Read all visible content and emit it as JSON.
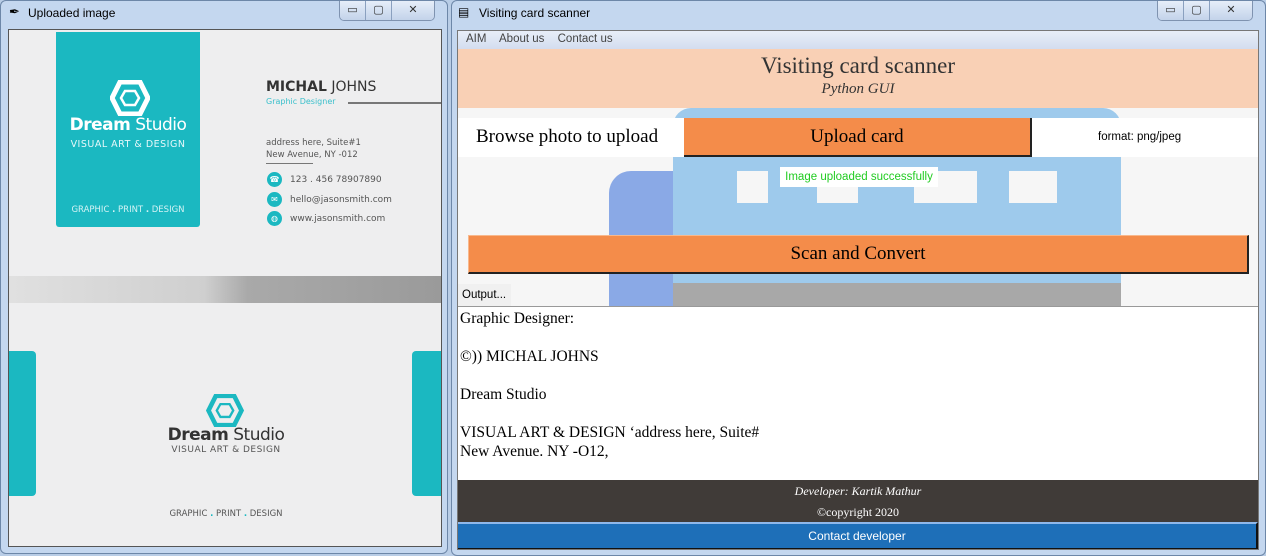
{
  "left_window": {
    "title": "Uploaded image",
    "card_front": {
      "brand_bold": "Dream",
      "brand_light": "Studio",
      "tagline": "VISUAL ART & DESIGN",
      "services": [
        "GRAPHIC",
        ".",
        "PRINT",
        ".",
        "DESIGN"
      ],
      "name_bold": "MICHAL",
      "name_light": "JOHNS",
      "role": "Graphic Designer",
      "address_line1": "address here, Suite#1",
      "address_line2": "New Avenue, NY -012",
      "phone": "123 . 456  78907890",
      "email": "hello@jasonsmith.com",
      "website": "www.jasonsmith.com"
    },
    "card_back": {
      "brand_bold": "Dream",
      "brand_light": "Studio",
      "tagline": "VISUAL ART & DESIGN",
      "services": [
        "GRAPHIC",
        ".",
        "PRINT",
        ".",
        "DESIGN"
      ]
    },
    "accent": "#1bb8c1"
  },
  "right_window": {
    "title": "Visiting card scanner",
    "menu": [
      "AIM",
      "About us",
      "Contact us"
    ],
    "header": {
      "title": "Visiting card scanner",
      "subtitle": "Python GUI"
    },
    "browse_label": "Browse photo to upload",
    "upload_button": "Upload card",
    "format_label": "format: png/jpeg",
    "status": "Image uploaded successfully",
    "scan_button": "Scan and Convert",
    "output_label": "Output...",
    "output_lines": [
      "Graphic Designer:",
      "",
      "©)) MICHAL JOHNS",
      "",
      "Dream Studio",
      "",
      "VISUAL ART & DESIGN ‘address here, Suite#",
      "New Avenue. NY -O12,"
    ],
    "footer": {
      "developer": "Developer: Kartik Mathur",
      "copyright": "©copyright 2020"
    },
    "contact_button": "Contact developer",
    "colors": {
      "header": "#f9d0b5",
      "button": "#f48c4a",
      "status": "#22cc22",
      "footer": "#403b38",
      "contact": "#1e6fb8"
    }
  }
}
